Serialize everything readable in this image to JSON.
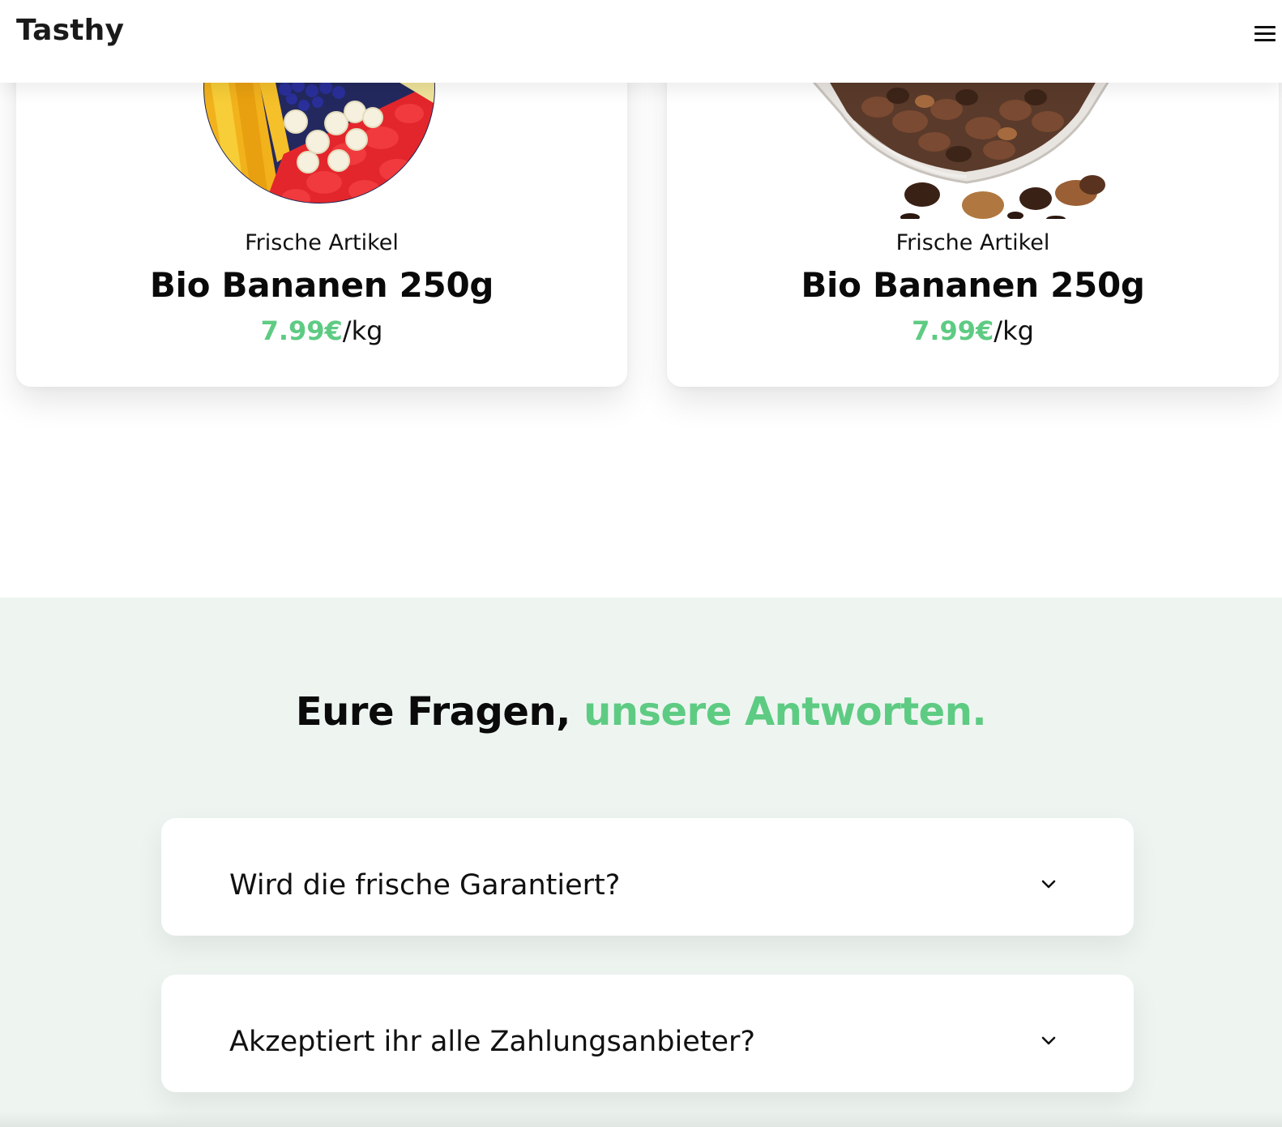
{
  "header": {
    "brand": "Tasthy",
    "menu_icon": "hamburger-menu-icon"
  },
  "products": [
    {
      "category": "Frische Artikel",
      "name": "Bio Bananen 250g",
      "price": "7.99€",
      "unit": "/kg",
      "image": "fruit-bowl-image"
    },
    {
      "category": "Frische Artikel",
      "name": "Bio Bananen 250g",
      "price": "7.99€",
      "unit": "/kg",
      "image": "nut-bowl-image"
    }
  ],
  "faq": {
    "title_main": "Eure Fragen,",
    "title_accent": "unsere Antworten.",
    "items": [
      {
        "question": "Wird die frische Garantiert?",
        "icon": "chevron-down-icon"
      },
      {
        "question": "Akzeptiert ihr alle Zahlungsanbieter?",
        "icon": "chevron-down-icon"
      }
    ]
  },
  "colors": {
    "accent": "#5ecb83",
    "faq_background": "#eef5f1",
    "text": "#0a0a0a"
  }
}
